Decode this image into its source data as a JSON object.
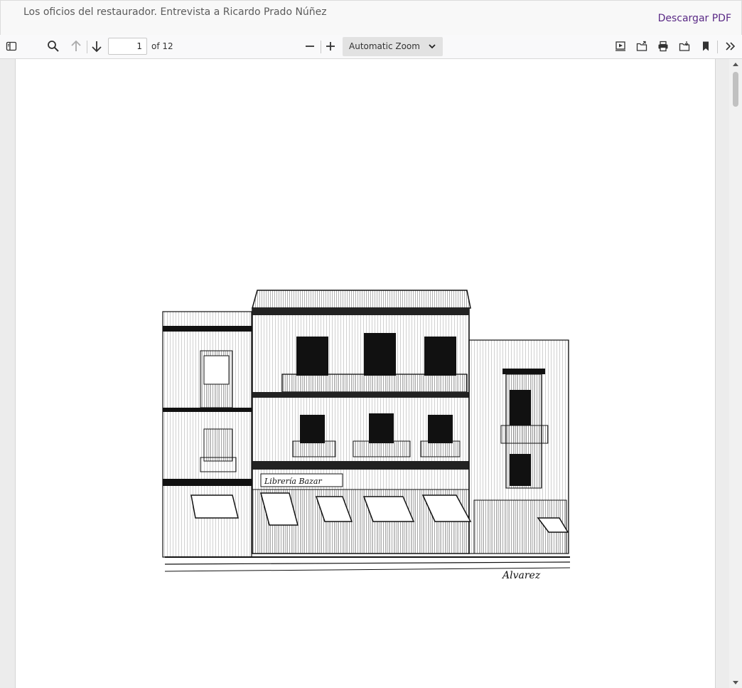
{
  "header": {
    "title": "Los oficios del restaurador. Entrevista a Ricardo Prado Núñez",
    "download_label": "Descargar PDF"
  },
  "toolbar": {
    "icons": [
      "sidebar-toggle-icon",
      "search-icon",
      "arrow-up-icon",
      "arrow-down-icon",
      "zoom-out-icon",
      "zoom-in-icon",
      "presentation-icon",
      "open-file-icon",
      "print-icon",
      "save-icon",
      "bookmark-icon",
      "more-tools-icon"
    ],
    "page_number": "1",
    "page_count_label": "of 12",
    "zoom_label": "Automatic Zoom"
  },
  "document": {
    "illustration": "building-facade-sketch"
  },
  "colors": {
    "link": "#5a2a86",
    "toolbar_bg": "#f9f9fa",
    "viewer_bg": "#ececec"
  }
}
